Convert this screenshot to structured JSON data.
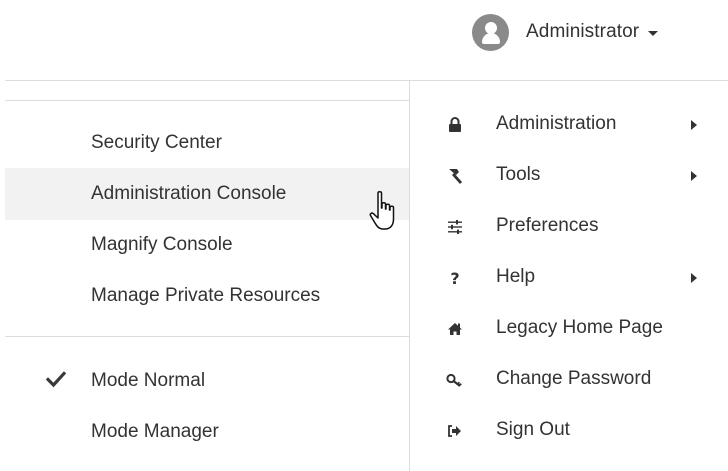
{
  "user": {
    "name": "Administrator",
    "avatar_icon": "user-avatar-icon",
    "dropdown_icon": "caret-down-icon"
  },
  "submenu": {
    "items": [
      {
        "label": "Security Center",
        "hovered": false
      },
      {
        "label": "Administration Console",
        "hovered": true
      },
      {
        "label": "Magnify Console",
        "hovered": false
      },
      {
        "label": "Manage Private Resources",
        "hovered": false
      }
    ],
    "modes": [
      {
        "label": "Mode Normal",
        "checked": true
      },
      {
        "label": "Mode Manager",
        "checked": false
      }
    ]
  },
  "menu": {
    "items": [
      {
        "label": "Administration",
        "icon": "lock-icon",
        "has_submenu": true
      },
      {
        "label": "Tools",
        "icon": "hammer-icon",
        "has_submenu": true
      },
      {
        "label": "Preferences",
        "icon": "sliders-icon",
        "has_submenu": false
      },
      {
        "label": "Help",
        "icon": "question-icon",
        "has_submenu": true
      },
      {
        "label": "Legacy Home Page",
        "icon": "home-icon",
        "has_submenu": false
      },
      {
        "label": "Change Password",
        "icon": "key-icon",
        "has_submenu": false
      },
      {
        "label": "Sign Out",
        "icon": "sign-out-icon",
        "has_submenu": false
      }
    ]
  },
  "colors": {
    "text": "#333333",
    "hover_bg": "#f2f2f2",
    "divider": "#dcdcdc",
    "avatar_bg": "#8a8a8a"
  }
}
